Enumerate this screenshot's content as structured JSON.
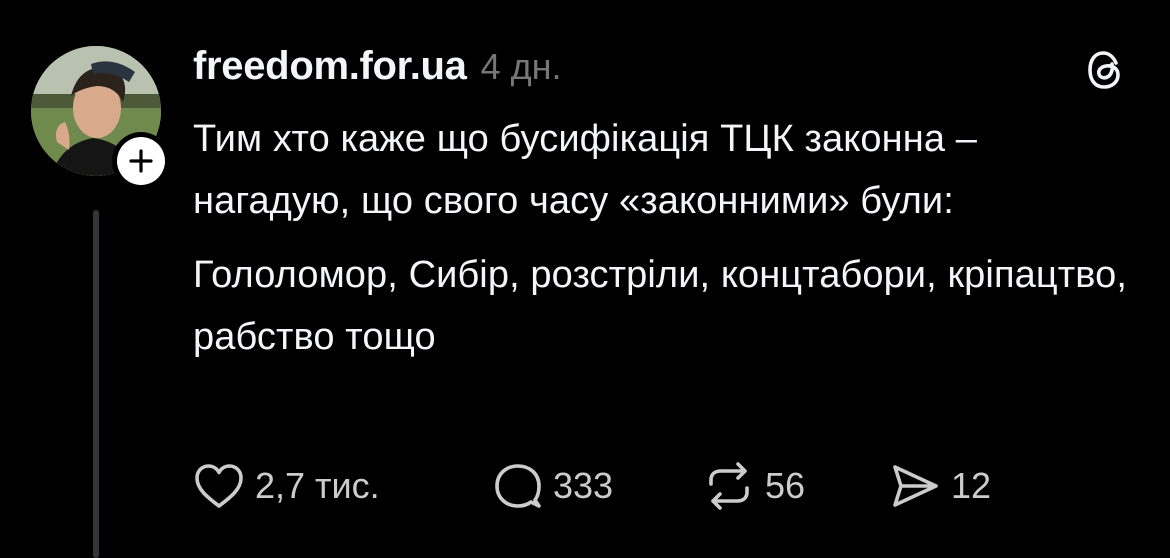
{
  "post": {
    "author": {
      "username": "freedom.for.ua",
      "avatar_icon": "profile-photo",
      "follow_icon": "plus-icon"
    },
    "timestamp": "4 дн.",
    "app_icon": "threads-logo-icon",
    "text": [
      "Тим хто каже що бусифікація ТЦК законна – нагадую, що свого часу «законними» були:",
      "Гололомор, Сибір, розстріли, концтабори, кріпацтво, рабство тощо"
    ],
    "actions": {
      "like": {
        "icon": "heart-icon",
        "count": "2,7 тис."
      },
      "reply": {
        "icon": "comment-icon",
        "count": "333"
      },
      "repost": {
        "icon": "repost-icon",
        "count": "56"
      },
      "share": {
        "icon": "send-icon",
        "count": "12"
      }
    }
  },
  "colors": {
    "background": "#000000",
    "primary_text": "#f3f5f7",
    "secondary_text": "#777777",
    "count_text": "#cccccc",
    "thread_line": "#333638"
  }
}
